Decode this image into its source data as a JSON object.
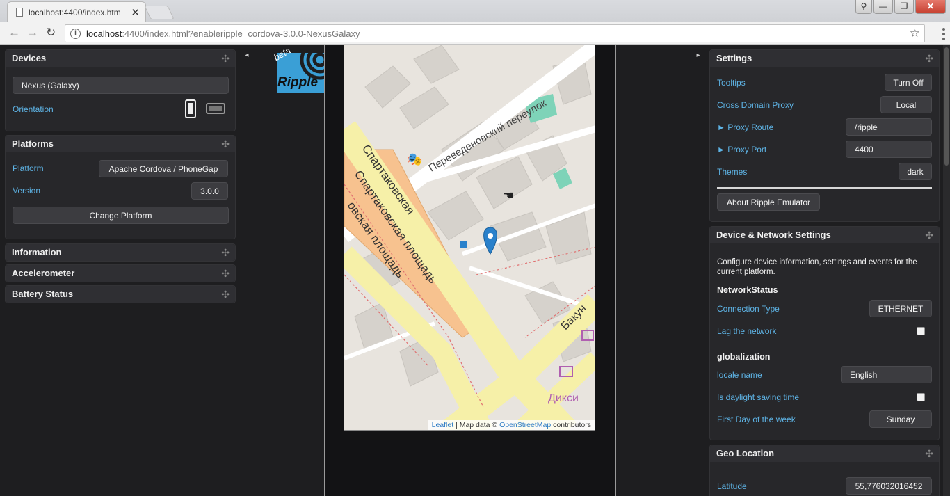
{
  "browser": {
    "tab_title": "localhost:4400/index.htm",
    "url_host": "localhost",
    "url_rest": ":4400/index.html?enableripple=cordova-3.0.0-NexusGalaxy"
  },
  "devices": {
    "title": "Devices",
    "device": "Nexus (Galaxy)",
    "orientation_label": "Orientation"
  },
  "platforms": {
    "title": "Platforms",
    "platform_label": "Platform",
    "platform_value": "Apache Cordova / PhoneGap",
    "version_label": "Version",
    "version_value": "3.0.0",
    "change_button": "Change Platform"
  },
  "collapsed_panels": [
    "Information",
    "Accelerometer",
    "Battery Status"
  ],
  "logo": {
    "badge": "beta",
    "name": "Ripple"
  },
  "map": {
    "streets": [
      "Переведеновский переулок",
      "Спартаковская",
      "Спартаковская площадь",
      "овская площадь",
      "Бакун",
      "Дикси"
    ],
    "attribution_leaflet": "Leaflet",
    "attribution_mid": " | Map data © ",
    "attribution_osm": "OpenStreetMap",
    "attribution_end": " contributors"
  },
  "settings": {
    "title": "Settings",
    "tooltips_label": "Tooltips",
    "tooltips_value": "Turn Off",
    "proxy_label": "Cross Domain Proxy",
    "proxy_value": "Local",
    "route_label": "► Proxy Route",
    "route_value": "/ripple",
    "port_label": "► Proxy Port",
    "port_value": "4400",
    "themes_label": "Themes",
    "themes_value": "dark",
    "about_button": "About Ripple Emulator"
  },
  "device_network": {
    "title": "Device & Network Settings",
    "description": "Configure device information, settings and events for the current platform.",
    "network_heading": "NetworkStatus",
    "connection_label": "Connection Type",
    "connection_value": "ETHERNET",
    "lag_label": "Lag the network",
    "glob_heading": "globalization",
    "locale_label": "locale name",
    "locale_value": "English",
    "dst_label": "Is daylight saving time",
    "first_day_label": "First Day of the week",
    "first_day_value": "Sunday"
  },
  "geo": {
    "title": "Geo Location",
    "latitude_label": "Latitude",
    "latitude_value": "55,776032016452"
  },
  "colors": {
    "accent": "#5eb4e6",
    "panel_bg": "#27272a",
    "page_bg": "#1e1e20",
    "marker": "#2a81cb"
  }
}
